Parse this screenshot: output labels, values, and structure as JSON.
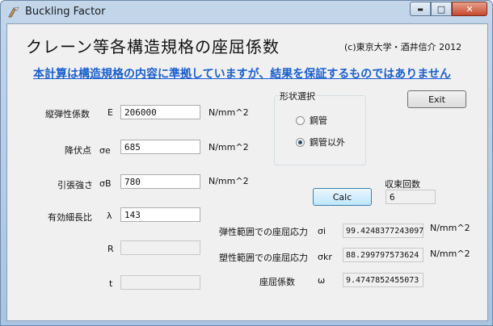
{
  "window": {
    "title": "Buckling Factor",
    "min_glyph": "▬",
    "max_glyph": "□",
    "close_glyph": "✕"
  },
  "header": {
    "heading": "クレーン等各構造規格の座屈係数",
    "copyright": "(c)東京大学・酒井信介 2012"
  },
  "disclaimer": "本計算は構造規格の内容に準拠していますが、結果を保証するものではありません",
  "inputs": {
    "E": {
      "label": "縦弾性係数",
      "symbol": "E",
      "value": "206000",
      "unit": "N/mm^2"
    },
    "yield": {
      "label": "降伏点",
      "symbol": "σe",
      "value": "685",
      "unit": "N/mm^2"
    },
    "tensile": {
      "label": "引張強さ",
      "symbol": "σB",
      "value": "780",
      "unit": "N/mm^2"
    },
    "slenderness": {
      "label": "有効細長比",
      "symbol": "λ",
      "value": "143"
    },
    "R": {
      "label": "R",
      "value": ""
    },
    "t": {
      "label": "t",
      "value": ""
    }
  },
  "shape": {
    "title": "形状選択",
    "options": [
      "鋼管",
      "鋼管以外"
    ],
    "selected": "鋼管以外"
  },
  "buttons": {
    "exit": "Exit",
    "calc": "Calc"
  },
  "convergence": {
    "label": "収束回数",
    "value": "6"
  },
  "results": {
    "elastic": {
      "label": "弾性範囲での座屈応力",
      "symbol": "σi",
      "value": "99.4248377243097",
      "unit": "N/mm^2"
    },
    "plastic": {
      "label": "塑性範囲での座屈応力",
      "symbol": "σkr",
      "value": "88.299797573624",
      "unit": "N/mm^2"
    },
    "factor": {
      "label": "座屈係数",
      "symbol": "ω",
      "value": "9.4747852455073"
    }
  }
}
